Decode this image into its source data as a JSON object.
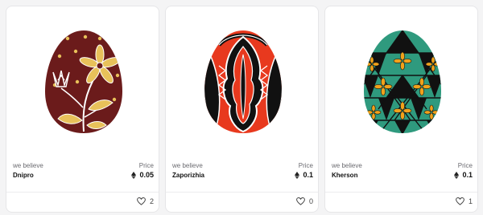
{
  "cards": [
    {
      "collection": "we believe",
      "name": "Dnipro",
      "price_label": "Price",
      "price": "0.05",
      "currency_icon": "ethereum-icon",
      "likes": "2",
      "colors": {
        "base": "#6b1b1b",
        "accent": "#e8c15a",
        "line": "#ffffff"
      }
    },
    {
      "collection": "we believe",
      "name": "Zaporizhia",
      "price_label": "Price",
      "price": "0.1",
      "currency_icon": "ethereum-icon",
      "likes": "0",
      "colors": {
        "base": "#e8391e",
        "accent": "#111111",
        "line": "#ffffff"
      }
    },
    {
      "collection": "we believe",
      "name": "Kherson",
      "price_label": "Price",
      "price": "0.1",
      "currency_icon": "ethereum-icon",
      "likes": "1",
      "colors": {
        "base": "#2f9a7e",
        "accent": "#f1a21b",
        "line": "#111111"
      }
    }
  ]
}
